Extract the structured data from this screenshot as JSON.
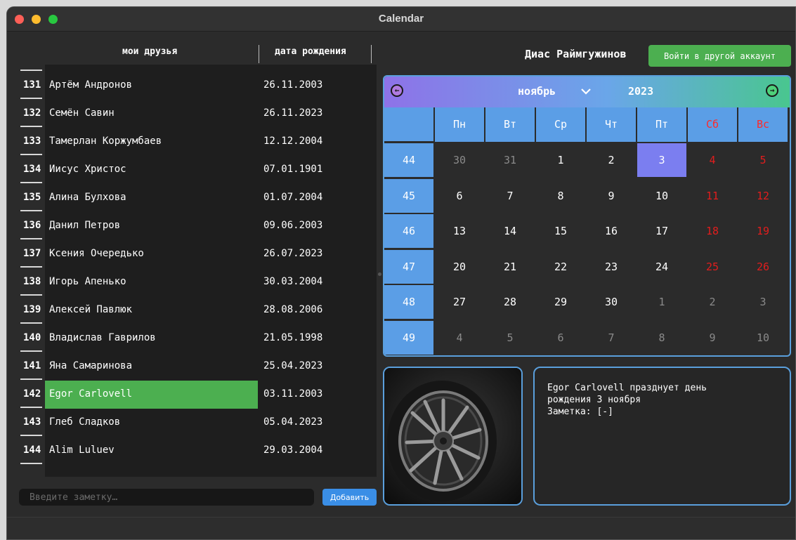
{
  "window": {
    "title": "Calendar"
  },
  "friends": {
    "headers": {
      "name": "мои друзья",
      "date": "дата рождения"
    },
    "rows": [
      {
        "num": "131",
        "name": "Артём Андронов",
        "date": "26.11.2003"
      },
      {
        "num": "132",
        "name": "Семён Савин",
        "date": "26.11.2023"
      },
      {
        "num": "133",
        "name": "Тамерлан Коржумбаев",
        "date": "12.12.2004"
      },
      {
        "num": "134",
        "name": "Иисус Христос",
        "date": "07.01.1901"
      },
      {
        "num": "135",
        "name": "Алина Булхова",
        "date": "01.07.2004"
      },
      {
        "num": "136",
        "name": "Данил Петров",
        "date": "09.06.2003"
      },
      {
        "num": "137",
        "name": "Ксения Очередько",
        "date": "26.07.2023"
      },
      {
        "num": "138",
        "name": "Игорь Апенько",
        "date": "30.03.2004"
      },
      {
        "num": "139",
        "name": "Алексей Павлюк",
        "date": "28.08.2006"
      },
      {
        "num": "140",
        "name": "Владислав Гаврилов",
        "date": "21.05.1998"
      },
      {
        "num": "141",
        "name": "Яна Самаринова",
        "date": "25.04.2023"
      },
      {
        "num": "142",
        "name": "Egor Carlovell",
        "date": "03.11.2003",
        "selected": true
      },
      {
        "num": "143",
        "name": "Глеб Сладков",
        "date": "05.04.2023"
      },
      {
        "num": "144",
        "name": "Alim Luluev",
        "date": "29.03.2004"
      }
    ]
  },
  "note": {
    "placeholder": "Введите заметку…",
    "add_label": "Добавить"
  },
  "account": {
    "user_name": "Диас Раймгужинов",
    "switch_label": "Войти в другой аккаунт"
  },
  "calendar": {
    "month": "ноябрь",
    "year": "2023",
    "weekdays": [
      "Пн",
      "Вт",
      "Ср",
      "Чт",
      "Пт",
      "Сб",
      "Вс"
    ],
    "weeks": [
      {
        "num": "44",
        "days": [
          {
            "d": "30",
            "other": true
          },
          {
            "d": "31",
            "other": true
          },
          {
            "d": "1"
          },
          {
            "d": "2"
          },
          {
            "d": "3",
            "today": true
          },
          {
            "d": "4",
            "weekend": true
          },
          {
            "d": "5",
            "weekend": true
          }
        ]
      },
      {
        "num": "45",
        "days": [
          {
            "d": "6"
          },
          {
            "d": "7"
          },
          {
            "d": "8"
          },
          {
            "d": "9"
          },
          {
            "d": "10"
          },
          {
            "d": "11",
            "weekend": true
          },
          {
            "d": "12",
            "weekend": true
          }
        ]
      },
      {
        "num": "46",
        "days": [
          {
            "d": "13"
          },
          {
            "d": "14"
          },
          {
            "d": "15"
          },
          {
            "d": "16"
          },
          {
            "d": "17"
          },
          {
            "d": "18",
            "weekend": true
          },
          {
            "d": "19",
            "weekend": true
          }
        ]
      },
      {
        "num": "47",
        "days": [
          {
            "d": "20"
          },
          {
            "d": "21"
          },
          {
            "d": "22"
          },
          {
            "d": "23"
          },
          {
            "d": "24"
          },
          {
            "d": "25",
            "weekend": true
          },
          {
            "d": "26",
            "weekend": true
          }
        ]
      },
      {
        "num": "48",
        "days": [
          {
            "d": "27"
          },
          {
            "d": "28"
          },
          {
            "d": "29"
          },
          {
            "d": "30"
          },
          {
            "d": "1",
            "other": true
          },
          {
            "d": "2",
            "other": true
          },
          {
            "d": "3",
            "other": true
          }
        ]
      },
      {
        "num": "49",
        "days": [
          {
            "d": "4",
            "other": true
          },
          {
            "d": "5",
            "other": true
          },
          {
            "d": "6",
            "other": true
          },
          {
            "d": "7",
            "other": true
          },
          {
            "d": "8",
            "other": true
          },
          {
            "d": "9",
            "other": true
          },
          {
            "d": "10",
            "other": true
          }
        ]
      }
    ]
  },
  "info": {
    "lines": [
      "Egor Carlovell празднует день",
      "рождения 3 ноября",
      "Заметка: [-]"
    ]
  }
}
